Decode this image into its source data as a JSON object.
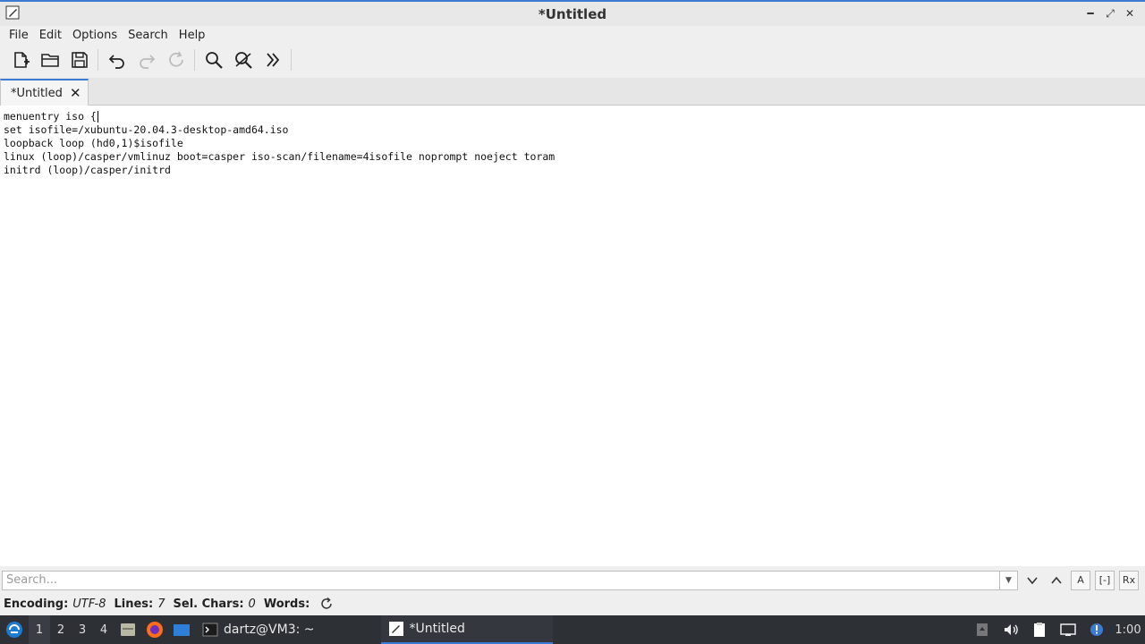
{
  "window": {
    "title": "*Untitled"
  },
  "menu": [
    "File",
    "Edit",
    "Options",
    "Search",
    "Help"
  ],
  "tab": {
    "label": "*Untitled",
    "close": "✕"
  },
  "editor": {
    "lines": [
      "menuentry iso {",
      "set isofile=/xubuntu-20.04.3-desktop-amd64.iso",
      "loopback loop (hd0,1)$isofile",
      "linux (loop)/casper/vmlinuz boot=casper iso-scan/filename=4isofile noprompt noeject toram",
      "initrd (loop)/casper/initrd"
    ]
  },
  "search": {
    "placeholder": "Search...",
    "toggle_whole_word": "[-]",
    "toggle_regex": "Rx",
    "toggle_case": "A"
  },
  "status": {
    "encoding_label": "Encoding:",
    "encoding_value": "UTF-8",
    "lines_label": "Lines:",
    "lines_value": "7",
    "sel_label": "Sel. Chars:",
    "sel_value": "0",
    "words_label": "Words:"
  },
  "taskbar": {
    "workspaces": [
      "1",
      "2",
      "3",
      "4"
    ],
    "terminal_label": "dartz@VM3: ~",
    "editor_label": "*Untitled",
    "clock": "1:00"
  }
}
